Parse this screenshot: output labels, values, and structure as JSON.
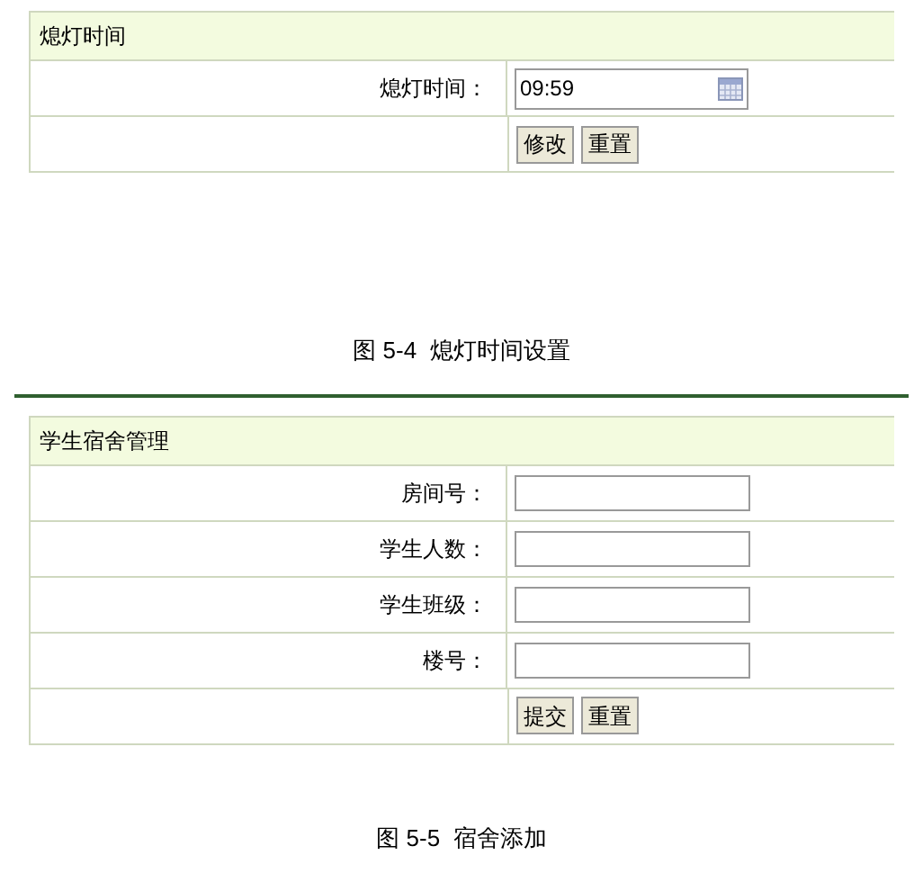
{
  "figures": [
    {
      "form": {
        "title": "熄灯时间",
        "fields": [
          {
            "label": "熄灯时间：",
            "value": "09:59",
            "kind": "date"
          }
        ],
        "buttons": [
          "修改",
          "重置"
        ]
      },
      "caption": "图 5-4  熄灯时间设置"
    },
    {
      "form": {
        "title": "学生宿舍管理",
        "fields": [
          {
            "label": "房间号：",
            "kind": "text"
          },
          {
            "label": "学生人数：",
            "kind": "text"
          },
          {
            "label": "学生班级：",
            "kind": "text"
          },
          {
            "label": "楼号：",
            "kind": "text"
          }
        ],
        "buttons": [
          "提交",
          "重置"
        ]
      },
      "caption": "图 5-5  宿舍添加"
    }
  ]
}
